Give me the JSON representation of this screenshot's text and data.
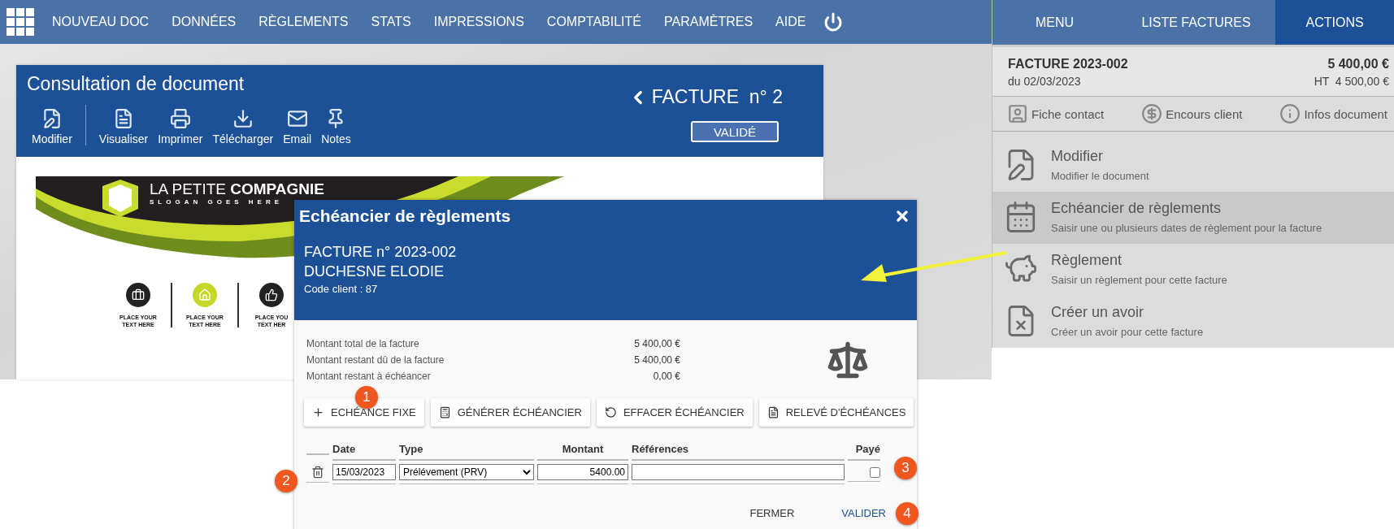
{
  "nav": {
    "items": [
      "NOUVEAU DOC",
      "DONNÉES",
      "RÈGLEMENTS",
      "STATS",
      "IMPRESSIONS",
      "COMPTABILITÉ",
      "PARAMÈTRES",
      "AIDE"
    ]
  },
  "document": {
    "title": "Consultation de document",
    "doc_type": "FACTURE",
    "doc_number": "n° 2",
    "status": "VALIDÉ",
    "toolbar": [
      {
        "label": "Modifier",
        "kind": "edit"
      },
      {
        "label": "Visualiser",
        "kind": "pdf"
      },
      {
        "label": "Imprimer",
        "kind": "print"
      },
      {
        "label": "Télécharger",
        "kind": "download"
      },
      {
        "label": "Email",
        "kind": "mail"
      },
      {
        "label": "Notes",
        "kind": "pin"
      }
    ],
    "letterhead": {
      "company_light": "LA PETITE",
      "company_bold": "COMPAGNIE",
      "slogan": "SLOGAN GOES HERE",
      "features": [
        {
          "kind": "briefcase",
          "line_1": "PLACE YOUR",
          "line_2": "TEXT HERE"
        },
        {
          "kind": "home",
          "line_1": "PLACE YOUR",
          "line_2": "TEXT HERE"
        },
        {
          "kind": "thumb",
          "line_1": "PLACE YOU",
          "line_2": "TEXT HER"
        }
      ]
    }
  },
  "side_panel": {
    "tabs": [
      {
        "label": "MENU",
        "selected": false
      },
      {
        "label": "LISTE FACTURES",
        "selected": false
      },
      {
        "label": "ACTIONS",
        "selected": true
      }
    ],
    "invoice": {
      "number": "FACTURE 2023-002",
      "date": "du 02/03/2023",
      "total": "5 400,00 €",
      "ht_label": "HT",
      "ht": "4 500,00 €"
    },
    "links": [
      {
        "label": "Fiche contact",
        "kind": "contact"
      },
      {
        "label": "Encours client",
        "kind": "money"
      },
      {
        "label": "Infos document",
        "kind": "info"
      }
    ],
    "actions": [
      {
        "title": "Modifier",
        "description": "Modifier le document",
        "kind": "edit",
        "selected": false
      },
      {
        "title": "Echéancier de règlements",
        "description": "Saisir une ou plusieurs dates de règlement pour la facture",
        "kind": "calendar",
        "selected": true
      },
      {
        "title": "Règlement",
        "description": "Saisir un règlement pour cette facture",
        "kind": "piggy",
        "selected": false
      },
      {
        "title": "Créer un avoir",
        "description": "Créer un avoir pour cette facture",
        "kind": "credit",
        "selected": false
      }
    ]
  },
  "modal": {
    "title": "Echéancier de règlements",
    "invoice": "FACTURE n° 2023-002",
    "client": "DUCHESNE ELODIE",
    "client_code": "Code client : 87",
    "summary": [
      {
        "label": "Montant total de la facture",
        "value": "5 400,00 €"
      },
      {
        "label": "Montant restant dû de la facture",
        "value": "5 400,00 €"
      },
      {
        "label": "Montant restant à échéancer",
        "value": "0,00 €"
      }
    ],
    "buttons": [
      {
        "label": "ECHÉANCE FIXE",
        "kind": "add"
      },
      {
        "label": "GÉNÉRER ÉCHÉANCIER",
        "kind": "generate"
      },
      {
        "label": "EFFACER ÉCHÉANCIER",
        "kind": "clear"
      },
      {
        "label": "RELEVÉ D'ÉCHÉANCES",
        "kind": "report"
      }
    ],
    "table": {
      "columns": [
        "Date",
        "Type",
        "Montant",
        "Références",
        "Payé"
      ],
      "rows": [
        {
          "date": "15/03/2023",
          "type": "Prélévement (PRV)",
          "amount": "5400.00",
          "paid": false
        }
      ]
    },
    "footer": [
      "FERMER",
      "VALIDER"
    ]
  },
  "annotations": [
    {
      "label": "1"
    },
    {
      "label": "2"
    },
    {
      "label": "3"
    },
    {
      "label": "4"
    }
  ]
}
